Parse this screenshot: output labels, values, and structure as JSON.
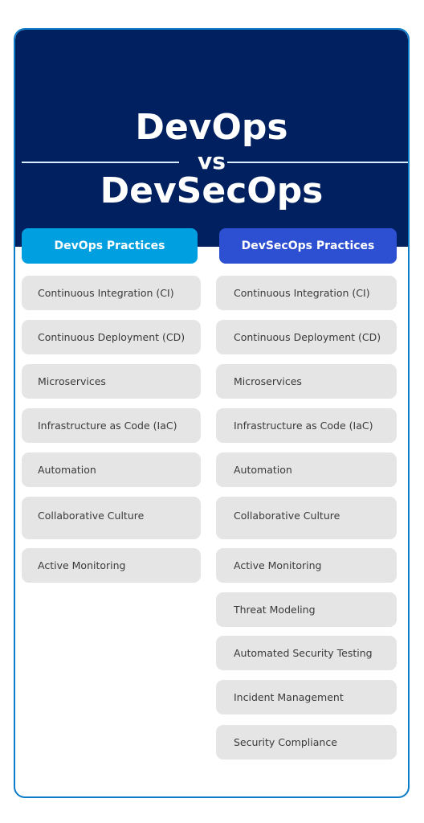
{
  "title": {
    "line1": "DevOps",
    "vs": "vs",
    "line2": "DevSecOps"
  },
  "colors": {
    "header_bg": "#002060",
    "devops_accent": "#009fe0",
    "devsecops_accent": "#2d4fd2",
    "card_border": "#0b7cc7",
    "item_bg": "#e5e5e5"
  },
  "columns": {
    "devops": {
      "heading": "DevOps Practices",
      "items": [
        "Continuous Integration (CI)",
        "Continuous Deployment (CD)",
        "Microservices",
        "Infrastructure as Code (IaC)",
        "Automation",
        "Collaborative Culture",
        "Active Monitoring"
      ]
    },
    "devsecops": {
      "heading": "DevSecOps Practices",
      "items": [
        "Continuous Integration (CI)",
        "Continuous Deployment (CD)",
        "Microservices",
        "Infrastructure as Code (IaC)",
        "Automation",
        "Collaborative Culture",
        "Active Monitoring",
        "Threat Modeling",
        "Automated Security Testing",
        "Incident Management",
        "Security Compliance"
      ]
    }
  }
}
